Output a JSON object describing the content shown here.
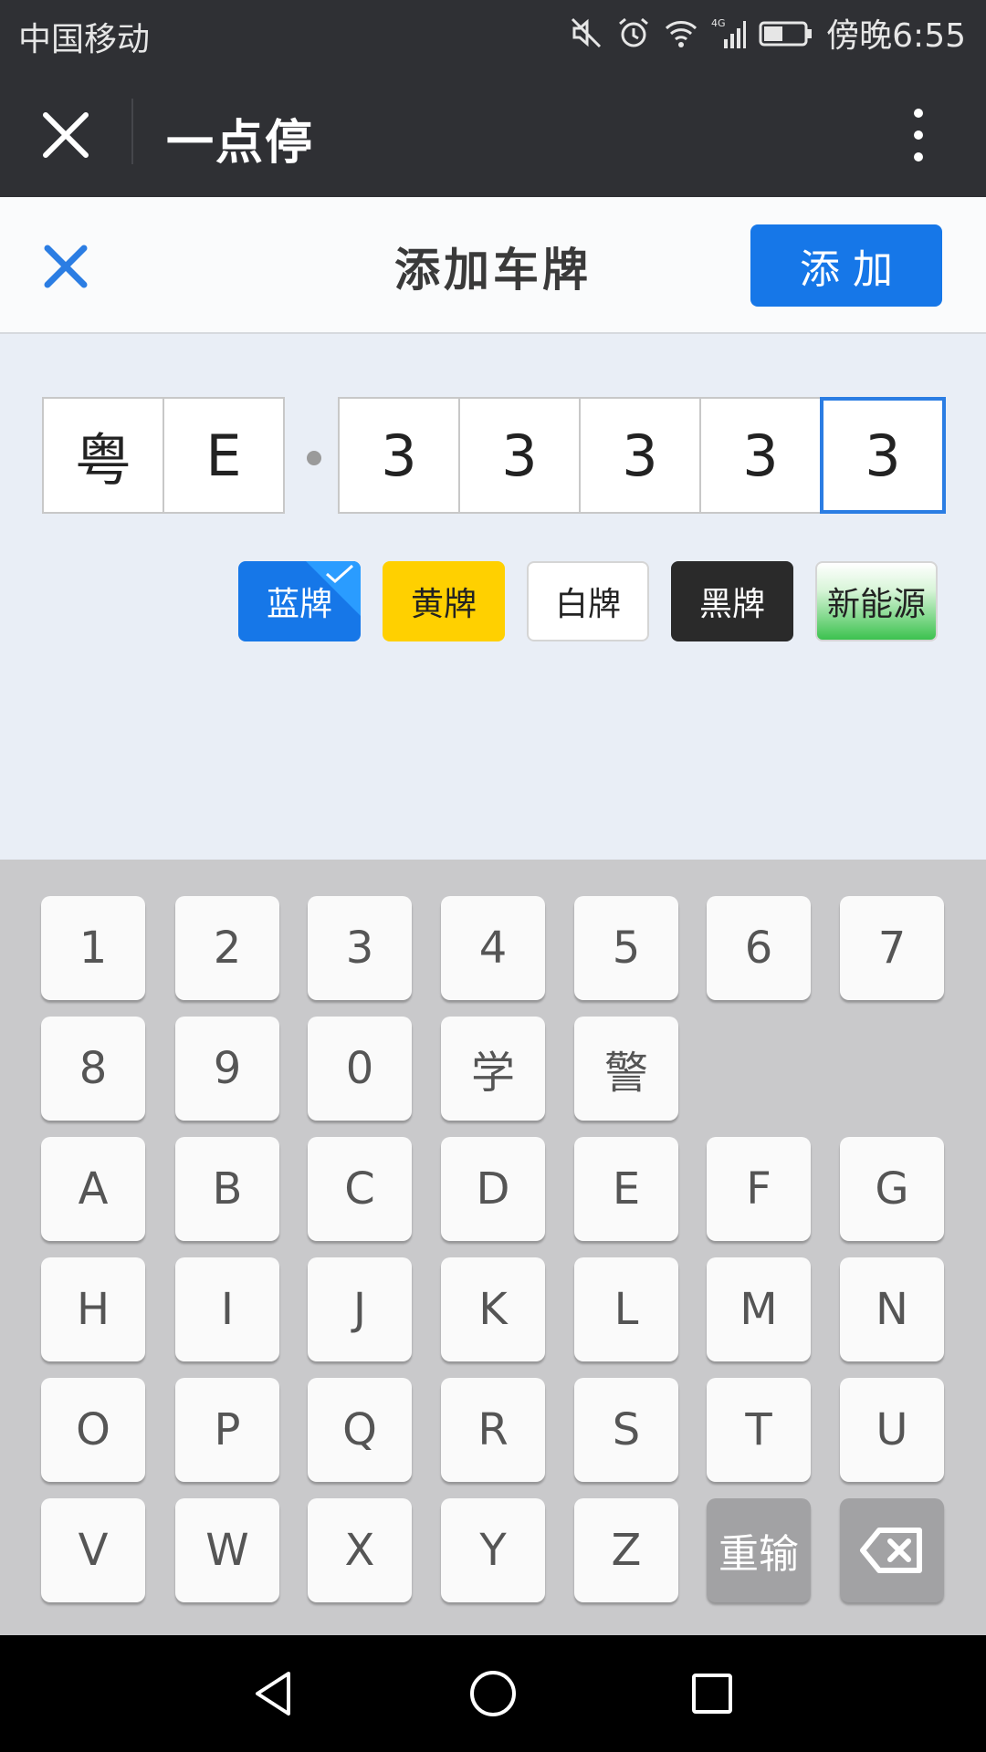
{
  "status_bar": {
    "carrier": "中国移动",
    "time": "傍晚6:55",
    "network": "4G"
  },
  "app_bar": {
    "title": "一点停"
  },
  "header": {
    "title": "添加车牌",
    "add_button": "添加"
  },
  "plate": {
    "province": "粤",
    "letter": "E",
    "digits": [
      "3",
      "3",
      "3",
      "3",
      "3"
    ]
  },
  "plate_colors": [
    {
      "label": "蓝牌",
      "selected": true
    },
    {
      "label": "黄牌",
      "selected": false
    },
    {
      "label": "白牌",
      "selected": false
    },
    {
      "label": "黑牌",
      "selected": false
    },
    {
      "label": "新能源",
      "selected": false
    }
  ],
  "keyboard": {
    "rows": [
      [
        "1",
        "2",
        "3",
        "4",
        "5",
        "6",
        "7"
      ],
      [
        "8",
        "9",
        "0",
        "学",
        "警"
      ],
      [
        "A",
        "B",
        "C",
        "D",
        "E",
        "F",
        "G"
      ],
      [
        "H",
        "I",
        "J",
        "K",
        "L",
        "M",
        "N"
      ],
      [
        "O",
        "P",
        "Q",
        "R",
        "S",
        "T",
        "U"
      ],
      [
        "V",
        "W",
        "X",
        "Y",
        "Z"
      ]
    ],
    "reset_label": "重输",
    "backspace_icon": "backspace-icon"
  },
  "colors": {
    "accent": "#1677e8",
    "dark_bar": "#2f3034",
    "plate_active_border": "#2b7de3"
  }
}
